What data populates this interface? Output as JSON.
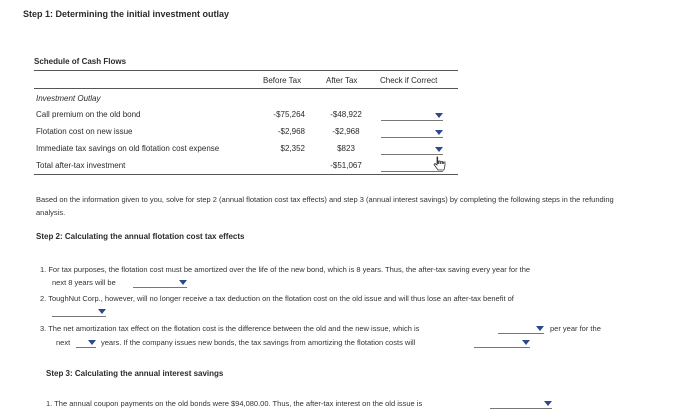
{
  "step1_heading": "Step 1: Determining the initial investment outlay",
  "schedule_title": "Schedule of Cash Flows",
  "columns": {
    "before_tax": "Before Tax",
    "after_tax": "After Tax",
    "check": "Check if Correct"
  },
  "rows": {
    "section": "Investment Outlay",
    "call_premium": {
      "label": "Call premium on the old bond",
      "before": "-$75,264",
      "after": "-$48,922"
    },
    "flotation": {
      "label": "Flotation cost on new issue",
      "before": "-$2,968",
      "after": "-$2,968"
    },
    "tax_savings": {
      "label": "Immediate tax savings on old flotation cost expense",
      "before": "$2,352",
      "after": "$823"
    },
    "total": {
      "label": "Total after-tax investment",
      "after": "-$51,067"
    }
  },
  "instructions": "Based on the information given to you, solve for step 2 (annual flotation cost tax effects) and step 3 (annual interest savings) by completing the following steps in the refunding analysis.",
  "step2_heading": "Step 2: Calculating the annual flotation cost tax effects",
  "q1": {
    "line1": "1. For tax purposes, the flotation cost must be amortized over the life of the new bond, which is 8 years. Thus, the after-tax saving every year for the",
    "line2": "next 8 years will be"
  },
  "q2": {
    "line1": "2. ToughNut Corp., however, will no longer receive a tax deduction on the flotation cost on the old issue and will thus lose an after-tax benefit of"
  },
  "q3": {
    "line1": "3. The net amortization tax effect on the flotation cost is the difference between the old and the new issue, which is",
    "per_year": "per year for the",
    "next": "next",
    "line2_rest": "years. If the company issues new bonds, the tax savings from amortizing the flotation costs will"
  },
  "step3_heading": "Step 3: Calculating the annual interest savings",
  "q4": {
    "line1": "1. The annual coupon payments on the old bonds were $94,080.00. Thus, the after-tax interest on the old issue is"
  }
}
